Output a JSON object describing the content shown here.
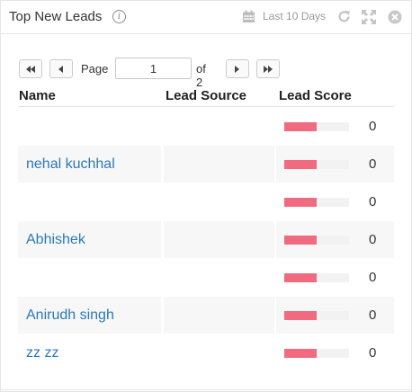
{
  "widget": {
    "title": "Top New Leads",
    "range_label": "Last 10 Days"
  },
  "pager": {
    "page_label": "Page",
    "current_page": "1",
    "of_label": "of 2"
  },
  "columns": {
    "name": "Name",
    "source": "Lead Source",
    "score": "Lead Score"
  },
  "rows": [
    {
      "name": "",
      "source": "",
      "score": "0",
      "bar_fill": 0.5
    },
    {
      "name": "nehal kuchhal",
      "source": "",
      "score": "0",
      "bar_fill": 0.5
    },
    {
      "name": "",
      "source": "",
      "score": "0",
      "bar_fill": 0.5
    },
    {
      "name": "Abhishek",
      "source": "",
      "score": "0",
      "bar_fill": 0.5
    },
    {
      "name": "",
      "source": "",
      "score": "0",
      "bar_fill": 0.5
    },
    {
      "name": "Anirudh singh",
      "source": "",
      "score": "0",
      "bar_fill": 0.5
    },
    {
      "name": "zz zz",
      "source": "",
      "score": "0",
      "bar_fill": 0.5
    }
  ],
  "colors": {
    "link": "#2a7ab8",
    "bar": "#f06a80"
  },
  "icons": [
    "info-icon",
    "calendar-icon",
    "refresh-icon",
    "expand-icon",
    "close-icon",
    "first-page-icon",
    "prev-page-icon",
    "next-page-icon",
    "last-page-icon"
  ]
}
